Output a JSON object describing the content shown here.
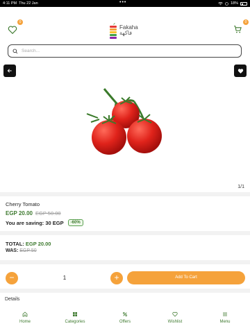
{
  "status_bar": {
    "time": "4:11 PM",
    "date": "Thu 22 Jan",
    "dots": "•••",
    "battery": "18%"
  },
  "header": {
    "logo_text_en": "Fakaha",
    "logo_text_ar": "فاكهة",
    "wishlist_badge": "0",
    "cart_badge": "0"
  },
  "search": {
    "placeholder": "Search..."
  },
  "product": {
    "image_counter": "1/1",
    "name": "Cherry Tomato",
    "price_now": "EGP 20.00",
    "price_was": "EGP 50.00",
    "saving_label": "You are saving: 30 EGP",
    "discount_badge": "-60%"
  },
  "summary": {
    "total_label": "TOTAL:",
    "total_value": "EGP 20.00",
    "was_label": "WAS:",
    "was_value": "EGP 50"
  },
  "cart": {
    "quantity": "1",
    "minus": "−",
    "plus": "+",
    "add_label": "Add To Cart"
  },
  "details_label": "Details",
  "nav": [
    {
      "label": "Home",
      "icon": "home-icon"
    },
    {
      "label": "Categories",
      "icon": "categories-icon"
    },
    {
      "label": "Offers",
      "icon": "percent-icon"
    },
    {
      "label": "Wishlist",
      "icon": "heart-icon"
    },
    {
      "label": "Menu",
      "icon": "menu-icon"
    }
  ],
  "colors": {
    "accent": "#f5a23b",
    "green": "#3e7a2f",
    "black": "#111111"
  }
}
